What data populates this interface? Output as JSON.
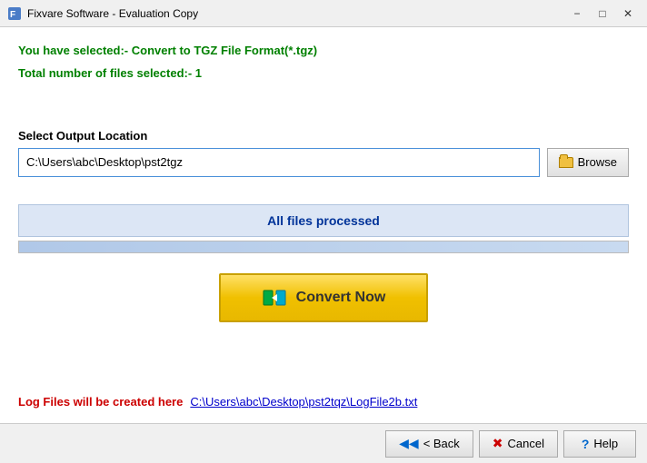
{
  "titleBar": {
    "title": "Fixvare Software - Evaluation Copy",
    "minimizeLabel": "−",
    "maximizeLabel": "□",
    "closeLabel": "✕"
  },
  "info": {
    "line1": "You have selected:- Convert to TGZ File Format(*.tgz)",
    "line2": "Total number of files selected:- 1"
  },
  "outputSection": {
    "label": "Select Output Location",
    "inputValue": "C:\\Users\\abc\\Desktop\\pst2tgz",
    "browseLabel": "Browse"
  },
  "statusBar": {
    "text": "All files processed"
  },
  "convertBtn": {
    "label": "Convert Now"
  },
  "logSection": {
    "label": "Log Files will be created here",
    "linkText": "C:\\Users\\abc\\Desktop\\pst2tqz\\LogFile2b.txt"
  },
  "bottomBar": {
    "backLabel": "< Back",
    "cancelLabel": "Cancel",
    "helpLabel": "Help"
  },
  "icons": {
    "backIcon": "◀",
    "cancelIcon": "✖",
    "helpIcon": "?"
  }
}
